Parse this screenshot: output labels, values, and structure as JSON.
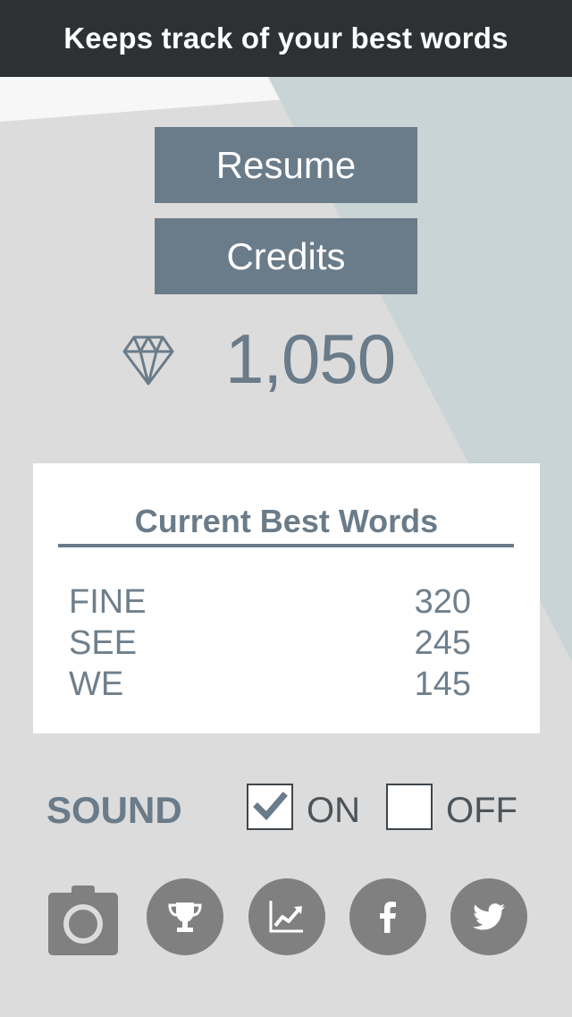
{
  "banner": {
    "text": "Keeps track of your best words"
  },
  "menu": {
    "resume_label": "Resume",
    "credits_label": "Credits"
  },
  "gems": {
    "icon": "diamond-icon",
    "count": "1,050"
  },
  "best_words": {
    "title": "Current Best Words",
    "rows": [
      {
        "word": "FINE",
        "score": "320"
      },
      {
        "word": "SEE",
        "score": "245"
      },
      {
        "word": "WE",
        "score": "145"
      }
    ]
  },
  "sound": {
    "label": "SOUND",
    "on_label": "ON",
    "off_label": "OFF",
    "on_checked": true,
    "off_checked": false
  },
  "actions": [
    {
      "icon": "camera-icon"
    },
    {
      "icon": "trophy-icon"
    },
    {
      "icon": "chart-icon"
    },
    {
      "icon": "facebook-icon"
    },
    {
      "icon": "twitter-icon"
    }
  ],
  "colors": {
    "banner_bg": "#2d3134",
    "button_bg": "#6a7b89",
    "background": "#dcdcdc",
    "accent_shape": "#c8d4d5",
    "icon_gray": "#808080"
  }
}
